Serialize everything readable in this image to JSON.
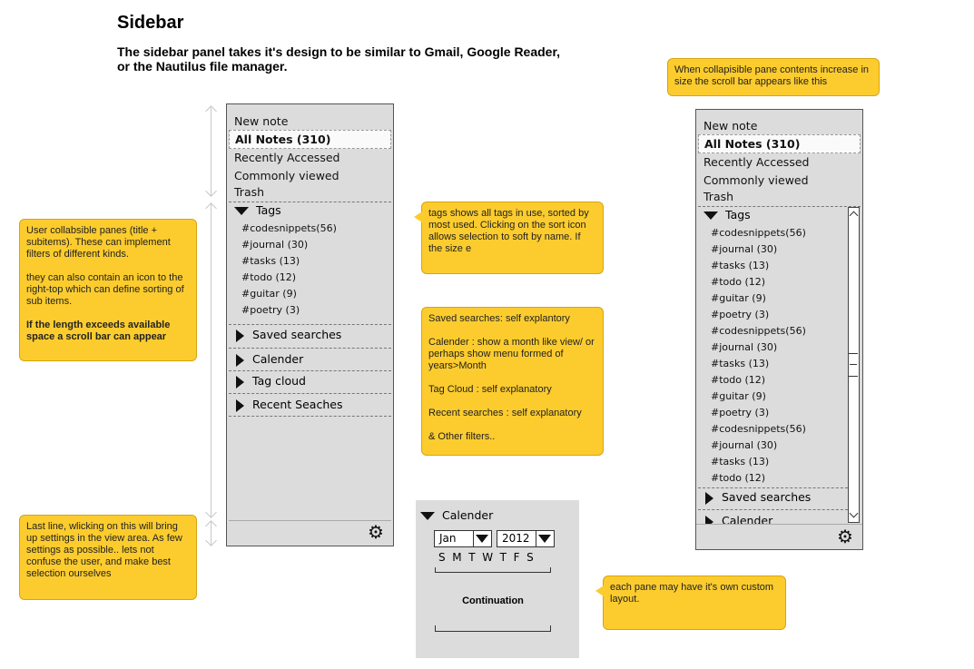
{
  "page": {
    "title": "Sidebar",
    "subtitle": "The sidebar panel takes it's design to be similar to Gmail, Google Reader,\nor the Nautilus file manager."
  },
  "notes": {
    "collapsible": {
      "p1": "User collabsible panes (title + subitems). These can implement filters of different kinds.",
      "p2": "they can also contain an icon to the right-top which can define sorting of sub items.",
      "p3": "If the length exceeds available space a scroll bar can appear"
    },
    "last_line": "Last line, wlicking on this will bring up settings in the view area. As few settings as possible.. lets not confuse the user, and make best selection ourselves",
    "tags": "tags shows all tags in use, sorted by most used. Clicking on the sort icon allows selection to soft by name. If the size e",
    "sections": {
      "p1": "Saved searches: self explantory",
      "p2": "Calender :  show a month like view/ or perhaps show menu formed of years>Month",
      "p3": "Tag Cloud : self explanatory",
      "p4": "Recent searches : self explanatory",
      "p5": "& Other filters.."
    },
    "scroll": "When collapisible pane contents increase in size the scroll bar appears like this",
    "custom": "each pane may have it's own custom layout."
  },
  "sidebar": {
    "top_items": [
      "New note",
      "All Notes (310)",
      "Recently Accessed",
      "Commonly viewed",
      "Trash"
    ],
    "tags_title": "Tags",
    "tags": [
      "#codesnippets(56)",
      "#journal (30)",
      "#tasks (13)",
      "#todo (12)",
      "#guitar (9)",
      "#poetry (3)"
    ],
    "sections": [
      "Saved searches",
      "Calender",
      "Tag cloud",
      "Recent Seaches"
    ],
    "settings_icon": "gear-icon"
  },
  "sidebar2": {
    "top_items": [
      "New note",
      "All Notes (310)",
      "Recently Accessed",
      "Commonly viewed",
      "Trash"
    ],
    "tags_title": "Tags",
    "tags": [
      "#codesnippets(56)",
      "#journal (30)",
      "#tasks (13)",
      "#todo (12)",
      "#guitar (9)",
      "#poetry (3)",
      "#codesnippets(56)",
      "#journal (30)",
      "#tasks (13)",
      "#todo (12)",
      "#guitar (9)",
      "#poetry (3)",
      "#codesnippets(56)",
      "#journal (30)",
      "#tasks (13)",
      "#todo (12)"
    ],
    "sections": [
      "Saved searches",
      "Calender"
    ],
    "settings_icon": "gear-icon"
  },
  "calendar": {
    "title": "Calender",
    "month": "Jan",
    "year": "2012",
    "weekdays": "S  M  T  W  T  F  S",
    "continuation": "Continuation"
  },
  "colors": {
    "note_bg": "#fccc2e",
    "panel_bg": "#dcdcdc",
    "arrow": "#c8c8c8"
  }
}
